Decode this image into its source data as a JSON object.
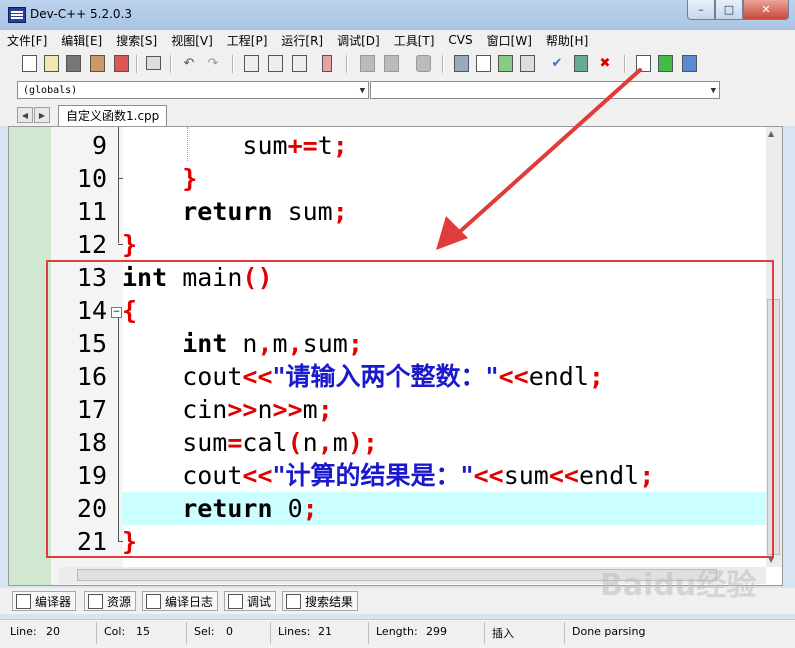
{
  "window": {
    "title": "Dev-C++ 5.2.0.3",
    "min": "–",
    "max": "□",
    "close": "✕"
  },
  "menu": [
    "文件[F]",
    "编辑[E]",
    "搜索[S]",
    "视图[V]",
    "工程[P]",
    "运行[R]",
    "调试[D]",
    "工具[T]",
    "CVS",
    "窗口[W]",
    "帮助[H]"
  ],
  "combo": {
    "left": "(globals)",
    "right": ""
  },
  "tab": {
    "filename": "自定义函数1.cpp"
  },
  "code": [
    {
      "ln": "9",
      "tokens": [
        {
          "t": "        sum",
          "c": ""
        },
        {
          "t": "+=",
          "c": "op"
        },
        {
          "t": "t",
          "c": ""
        },
        {
          "t": ";",
          "c": "op"
        }
      ]
    },
    {
      "ln": "10",
      "tokens": [
        {
          "t": "    ",
          "c": ""
        },
        {
          "t": "}",
          "c": "op"
        }
      ]
    },
    {
      "ln": "11",
      "tokens": [
        {
          "t": "    ",
          "c": ""
        },
        {
          "t": "return",
          "c": "kw"
        },
        {
          "t": " sum",
          "c": ""
        },
        {
          "t": ";",
          "c": "op"
        }
      ]
    },
    {
      "ln": "12",
      "tokens": [
        {
          "t": "}",
          "c": "op"
        }
      ]
    },
    {
      "ln": "13",
      "tokens": [
        {
          "t": "int",
          "c": "kw"
        },
        {
          "t": " main",
          "c": ""
        },
        {
          "t": "()",
          "c": "op"
        }
      ]
    },
    {
      "ln": "14",
      "tokens": [
        {
          "t": "{",
          "c": "op"
        }
      ]
    },
    {
      "ln": "15",
      "tokens": [
        {
          "t": "    ",
          "c": ""
        },
        {
          "t": "int",
          "c": "kw"
        },
        {
          "t": " n",
          "c": ""
        },
        {
          "t": ",",
          "c": "op"
        },
        {
          "t": "m",
          "c": ""
        },
        {
          "t": ",",
          "c": "op"
        },
        {
          "t": "sum",
          "c": ""
        },
        {
          "t": ";",
          "c": "op"
        }
      ]
    },
    {
      "ln": "16",
      "tokens": [
        {
          "t": "    cout",
          "c": ""
        },
        {
          "t": "<<",
          "c": "op"
        },
        {
          "t": "\"请输入两个整数：\"",
          "c": "str"
        },
        {
          "t": "<<",
          "c": "op"
        },
        {
          "t": "endl",
          "c": ""
        },
        {
          "t": ";",
          "c": "op"
        }
      ]
    },
    {
      "ln": "17",
      "tokens": [
        {
          "t": "    cin",
          "c": ""
        },
        {
          "t": ">>",
          "c": "op"
        },
        {
          "t": "n",
          "c": ""
        },
        {
          "t": ">>",
          "c": "op"
        },
        {
          "t": "m",
          "c": ""
        },
        {
          "t": ";",
          "c": "op"
        }
      ]
    },
    {
      "ln": "18",
      "tokens": [
        {
          "t": "    sum",
          "c": ""
        },
        {
          "t": "=",
          "c": "op"
        },
        {
          "t": "cal",
          "c": ""
        },
        {
          "t": "(",
          "c": "op"
        },
        {
          "t": "n",
          "c": ""
        },
        {
          "t": ",",
          "c": "op"
        },
        {
          "t": "m",
          "c": ""
        },
        {
          "t": ");",
          "c": "op"
        }
      ]
    },
    {
      "ln": "19",
      "tokens": [
        {
          "t": "    cout",
          "c": ""
        },
        {
          "t": "<<",
          "c": "op"
        },
        {
          "t": "\"计算的结果是：\"",
          "c": "str"
        },
        {
          "t": "<<",
          "c": "op"
        },
        {
          "t": "sum",
          "c": ""
        },
        {
          "t": "<<",
          "c": "op"
        },
        {
          "t": "endl",
          "c": ""
        },
        {
          "t": ";",
          "c": "op"
        }
      ]
    },
    {
      "ln": "20",
      "tokens": [
        {
          "t": "    ",
          "c": ""
        },
        {
          "t": "return",
          "c": "kw"
        },
        {
          "t": " 0",
          "c": "num"
        },
        {
          "t": ";",
          "c": "op"
        }
      ]
    },
    {
      "ln": "21",
      "tokens": [
        {
          "t": "}",
          "c": "op"
        }
      ]
    }
  ],
  "active_line": "20",
  "panel_tabs": [
    "编译器",
    "资源",
    "编译日志",
    "调试",
    "搜索结果"
  ],
  "status": {
    "line_label": "Line:",
    "line": "20",
    "col_label": "Col:",
    "col": "15",
    "sel_label": "Sel:",
    "sel": "0",
    "lines_label": "Lines:",
    "lines": "21",
    "length_label": "Length:",
    "length": "299",
    "mode": "插入",
    "message": "Done parsing"
  },
  "watermark": "Baidu经验",
  "colors": {
    "highlight_box": "#e03c3c",
    "active_line": "#ccffff",
    "gutter": "#cfe8cf"
  }
}
